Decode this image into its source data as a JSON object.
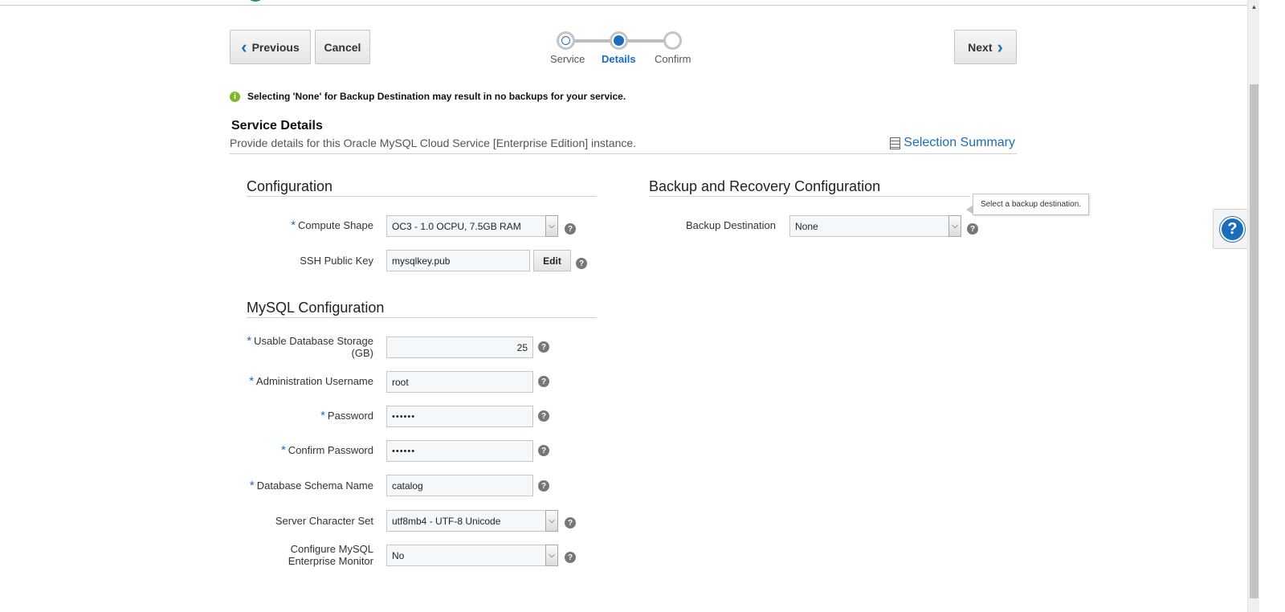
{
  "nav": {
    "previous_label": "Previous",
    "cancel_label": "Cancel",
    "next_label": "Next"
  },
  "train": {
    "steps": [
      {
        "label": "Service",
        "state": "visited"
      },
      {
        "label": "Details",
        "state": "current"
      },
      {
        "label": "Confirm",
        "state": "unvisited"
      }
    ]
  },
  "info_message": "Selecting 'None' for Backup Destination may result in no backups for your service.",
  "service_details": {
    "title": "Service Details",
    "description": "Provide details for this Oracle MySQL Cloud Service [Enterprise Edition] instance.",
    "selection_summary_label": "Selection Summary"
  },
  "configuration": {
    "title": "Configuration",
    "compute_shape": {
      "label": "Compute Shape",
      "value": "OC3 - 1.0 OCPU, 7.5GB RAM"
    },
    "ssh_public_key": {
      "label": "SSH Public Key",
      "value": "mysqlkey.pub",
      "edit_label": "Edit"
    }
  },
  "mysql_configuration": {
    "title": "MySQL Configuration",
    "storage": {
      "label_line1": "Usable Database Storage",
      "label_line2": "(GB)",
      "value": "25"
    },
    "admin_username": {
      "label": "Administration Username",
      "value": "root"
    },
    "password": {
      "label": "Password",
      "value": "••••••"
    },
    "confirm_password": {
      "label": "Confirm Password",
      "value": "••••••"
    },
    "schema_name": {
      "label": "Database Schema Name",
      "value": "catalog"
    },
    "character_set": {
      "label": "Server Character Set",
      "value": "utf8mb4 - UTF-8 Unicode"
    },
    "enterprise_monitor": {
      "label_line1": "Configure MySQL",
      "label_line2": "Enterprise Monitor",
      "value": "No"
    }
  },
  "backup": {
    "title": "Backup and Recovery Configuration",
    "destination": {
      "label": "Backup Destination",
      "value": "None"
    },
    "tooltip": "Select a backup destination."
  },
  "colors": {
    "accent": "#1a6dbb",
    "info_icon": "#7cb828"
  }
}
